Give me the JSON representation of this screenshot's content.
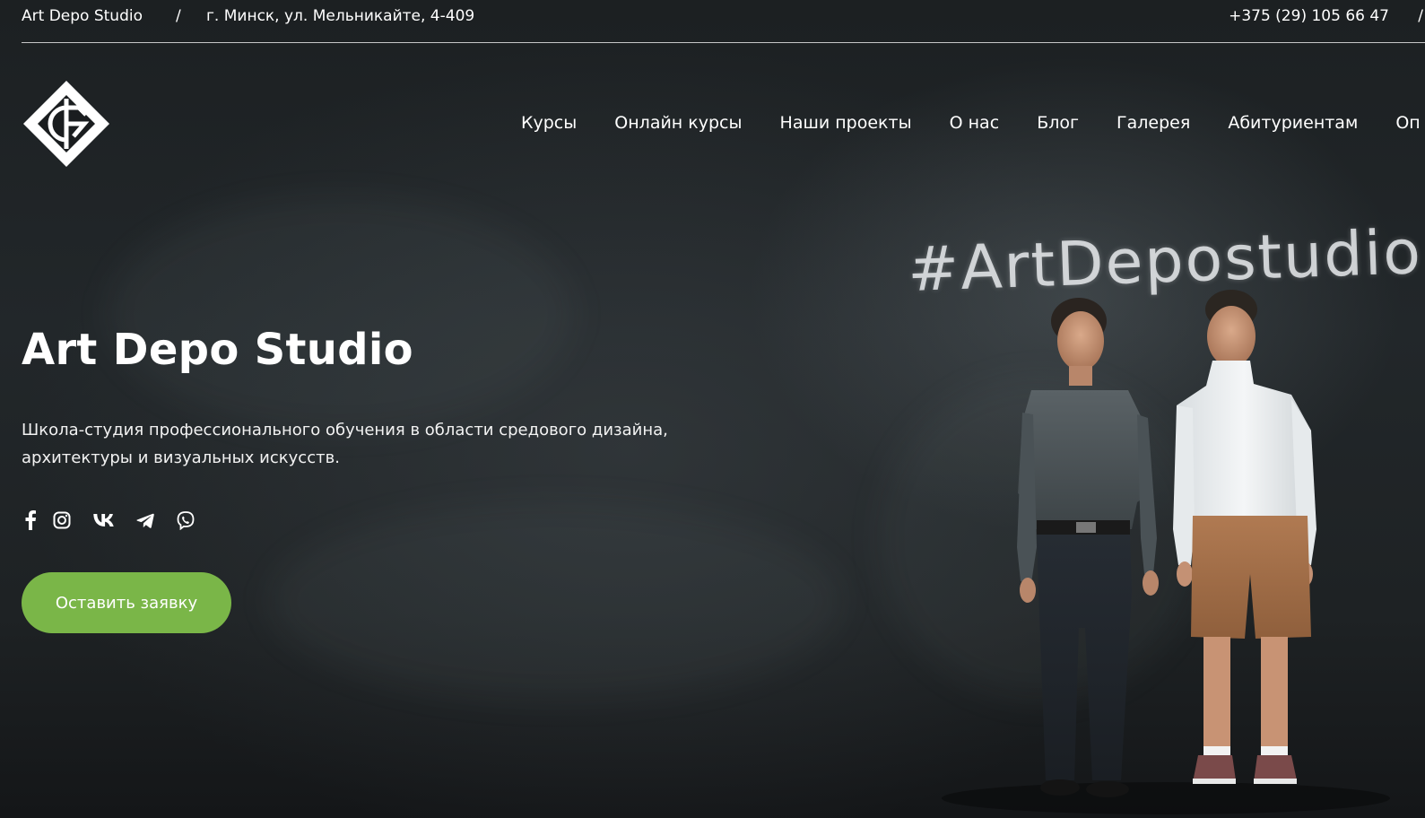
{
  "topbar": {
    "brand": "Art Depo Studio",
    "separator": "/",
    "address": "г. Минск, ул. Мельникайте, 4-409",
    "phone": "+375 (29) 105 66 47",
    "separator_right": "/"
  },
  "logo": {
    "icon": "diamond-logo-icon"
  },
  "nav": {
    "items": [
      {
        "label": "Курсы"
      },
      {
        "label": "Онлайн курсы"
      },
      {
        "label": "Наши проекты"
      },
      {
        "label": "О нас"
      },
      {
        "label": "Блог"
      },
      {
        "label": "Галерея"
      },
      {
        "label": "Абитуриентам"
      },
      {
        "label": "Оп"
      }
    ]
  },
  "hero": {
    "title": "Art Depo Studio",
    "subtitle_line1": "Школа-студия профессионального обучения в области средового дизайна,",
    "subtitle_line2": "архитектуры и визуальных искусств.",
    "cta_label": "Оставить заявку",
    "chalk_text": "#ArtDepostudio"
  },
  "socials": {
    "items": [
      {
        "icon": "facebook-icon"
      },
      {
        "icon": "instagram-icon"
      },
      {
        "icon": "vk-icon"
      },
      {
        "icon": "telegram-icon"
      },
      {
        "icon": "viber-icon"
      }
    ]
  },
  "colors": {
    "accent": "#7ab648",
    "background": "#1a1d1f",
    "text": "#ffffff"
  }
}
